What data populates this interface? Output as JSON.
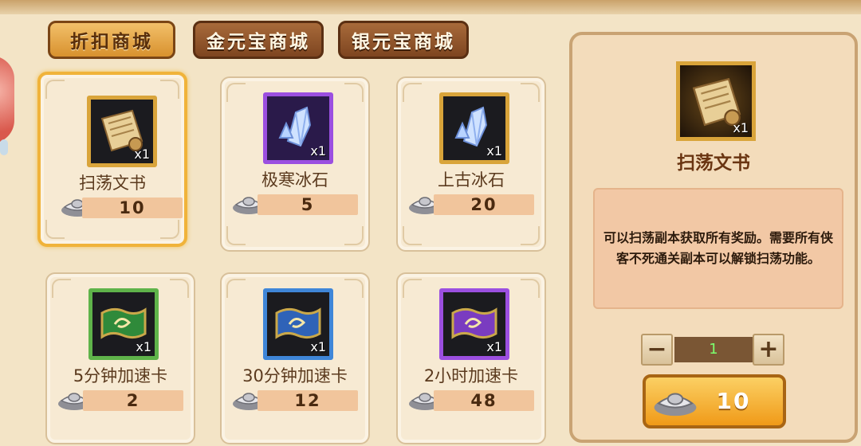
{
  "tabs": [
    {
      "label": "折扣商城",
      "active": true
    },
    {
      "label": "金元宝商城",
      "active": false
    },
    {
      "label": "银元宝商城",
      "active": false
    }
  ],
  "items": [
    {
      "name": "扫荡文书",
      "qty": "x1",
      "price": "10",
      "frame_color": "#d9a43a",
      "icon": "scroll-icon",
      "selected": true
    },
    {
      "name": "极寒冰石",
      "qty": "x1",
      "price": "5",
      "frame_color": "#9b4fe0",
      "icon": "ice-crystal-icon",
      "selected": false
    },
    {
      "name": "上古冰石",
      "qty": "x1",
      "price": "20",
      "frame_color": "#d9a43a",
      "icon": "ice-crystal-icon",
      "selected": false
    },
    {
      "name": "5分钟加速卡",
      "qty": "x1",
      "price": "2",
      "frame_color": "#5fb34a",
      "icon": "green-speed-card-icon",
      "selected": false
    },
    {
      "name": "30分钟加速卡",
      "qty": "x1",
      "price": "12",
      "frame_color": "#3f86d8",
      "icon": "blue-speed-card-icon",
      "selected": false
    },
    {
      "name": "2小时加速卡",
      "qty": "x1",
      "price": "48",
      "frame_color": "#9b4fe0",
      "icon": "purple-speed-card-icon",
      "selected": false
    }
  ],
  "detail": {
    "name": "扫荡文书",
    "qty": "x1",
    "description": "可以扫荡副本获取所有奖励。需要所有侠客不死通关副本可以解锁扫荡功能。",
    "quantity": "1",
    "minus_label": "−",
    "plus_label": "+",
    "price": "10"
  },
  "colors": {
    "accent": "#f0b33a",
    "price_bar": "#f1c59c"
  }
}
